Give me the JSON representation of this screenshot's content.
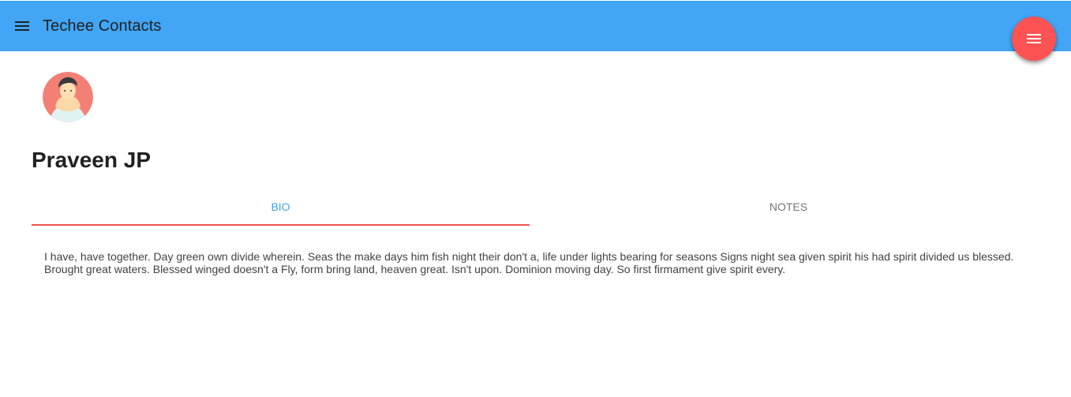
{
  "app": {
    "title": "Techee Contacts",
    "brand_color": "#42a5f5",
    "accent_color": "#ff5252"
  },
  "header": {
    "menu_icon": "hamburger-menu-icon",
    "fab_icon": "menu-lines-icon"
  },
  "contact": {
    "avatar_icon": "person-avatar-icon",
    "name": "Praveen JP"
  },
  "tabs": [
    {
      "label": "BIO",
      "active": true
    },
    {
      "label": "NOTES",
      "active": false
    }
  ],
  "bio": {
    "text": "I have, have together. Day green own divide wherein. Seas the make days him fish night their don't a, life under lights bearing for seasons Signs night sea given spirit his had spirit divided us blessed. Brought great waters. Blessed winged doesn't a Fly, form bring land, heaven great. Isn't upon. Dominion moving day. So first firmament give spirit every."
  }
}
